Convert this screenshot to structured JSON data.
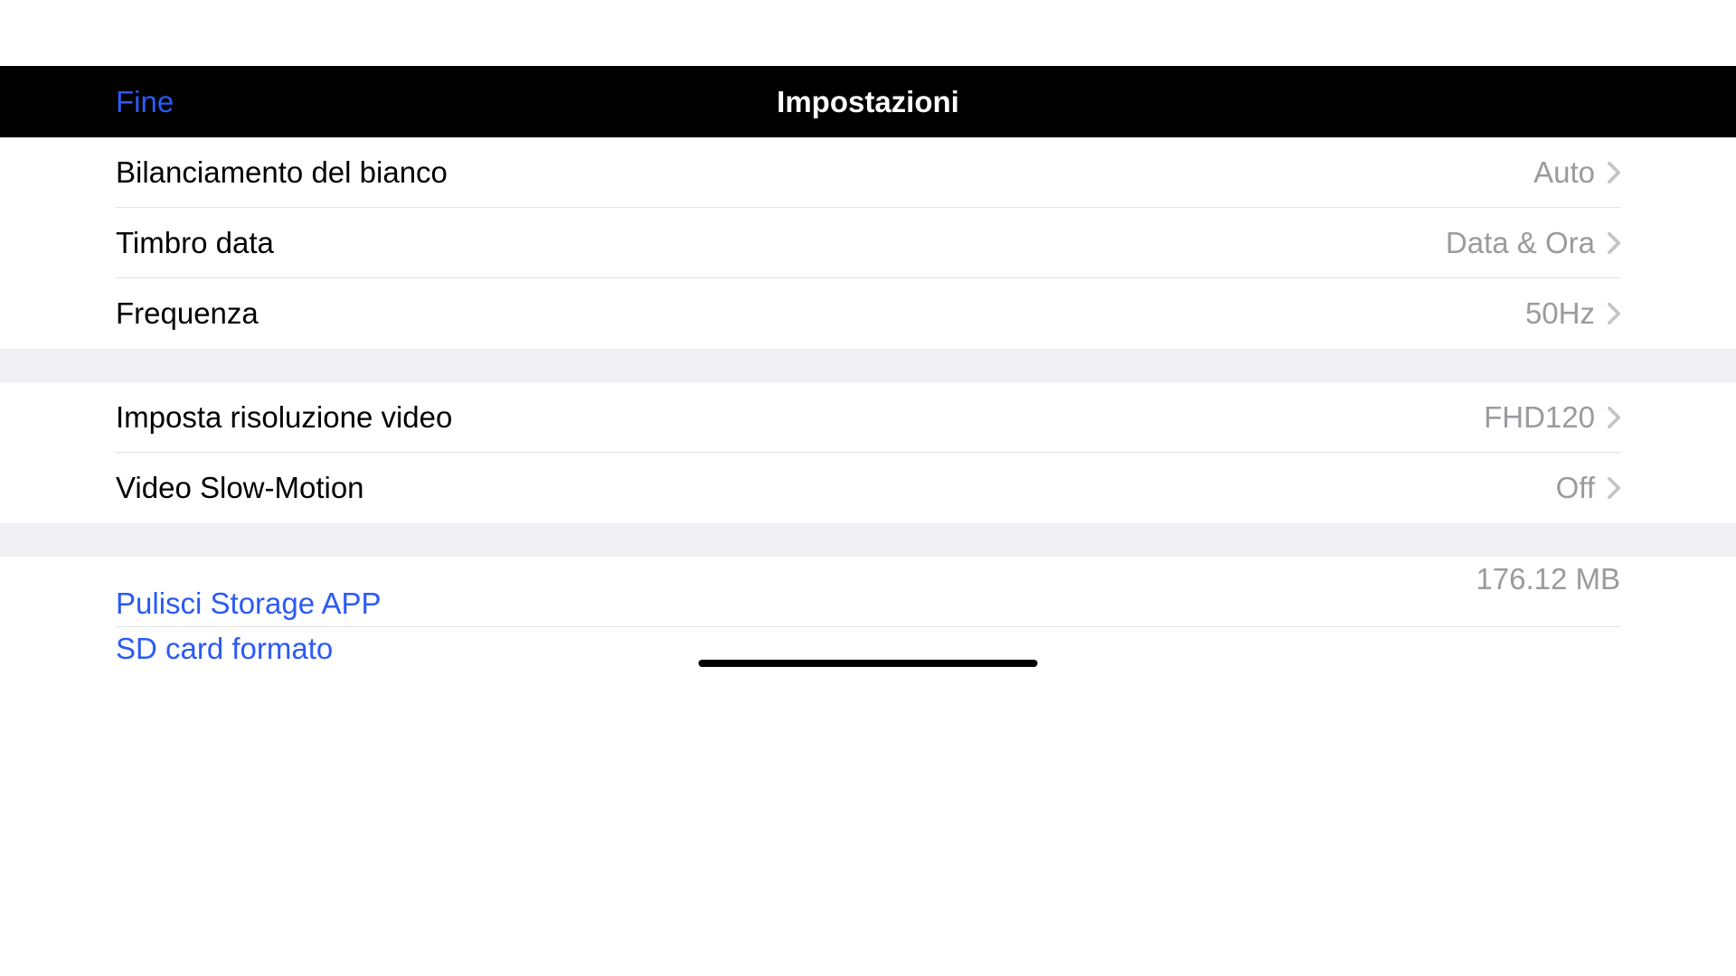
{
  "header": {
    "done_label": "Fine",
    "title": "Impostazioni"
  },
  "section1": {
    "white_balance": {
      "label": "Bilanciamento del bianco",
      "value": "Auto"
    },
    "date_stamp": {
      "label": "Timbro data",
      "value": "Data & Ora"
    },
    "frequency": {
      "label": "Frequenza",
      "value": "50Hz"
    }
  },
  "section2": {
    "video_resolution": {
      "label": "Imposta risoluzione video",
      "value": "FHD120"
    },
    "slow_motion": {
      "label": "Video Slow-Motion",
      "value": "Off"
    }
  },
  "section3": {
    "clean_storage": {
      "label": "Pulisci Storage APP",
      "value": "176.12 MB"
    },
    "sd_format": {
      "label": "SD card formato"
    }
  }
}
